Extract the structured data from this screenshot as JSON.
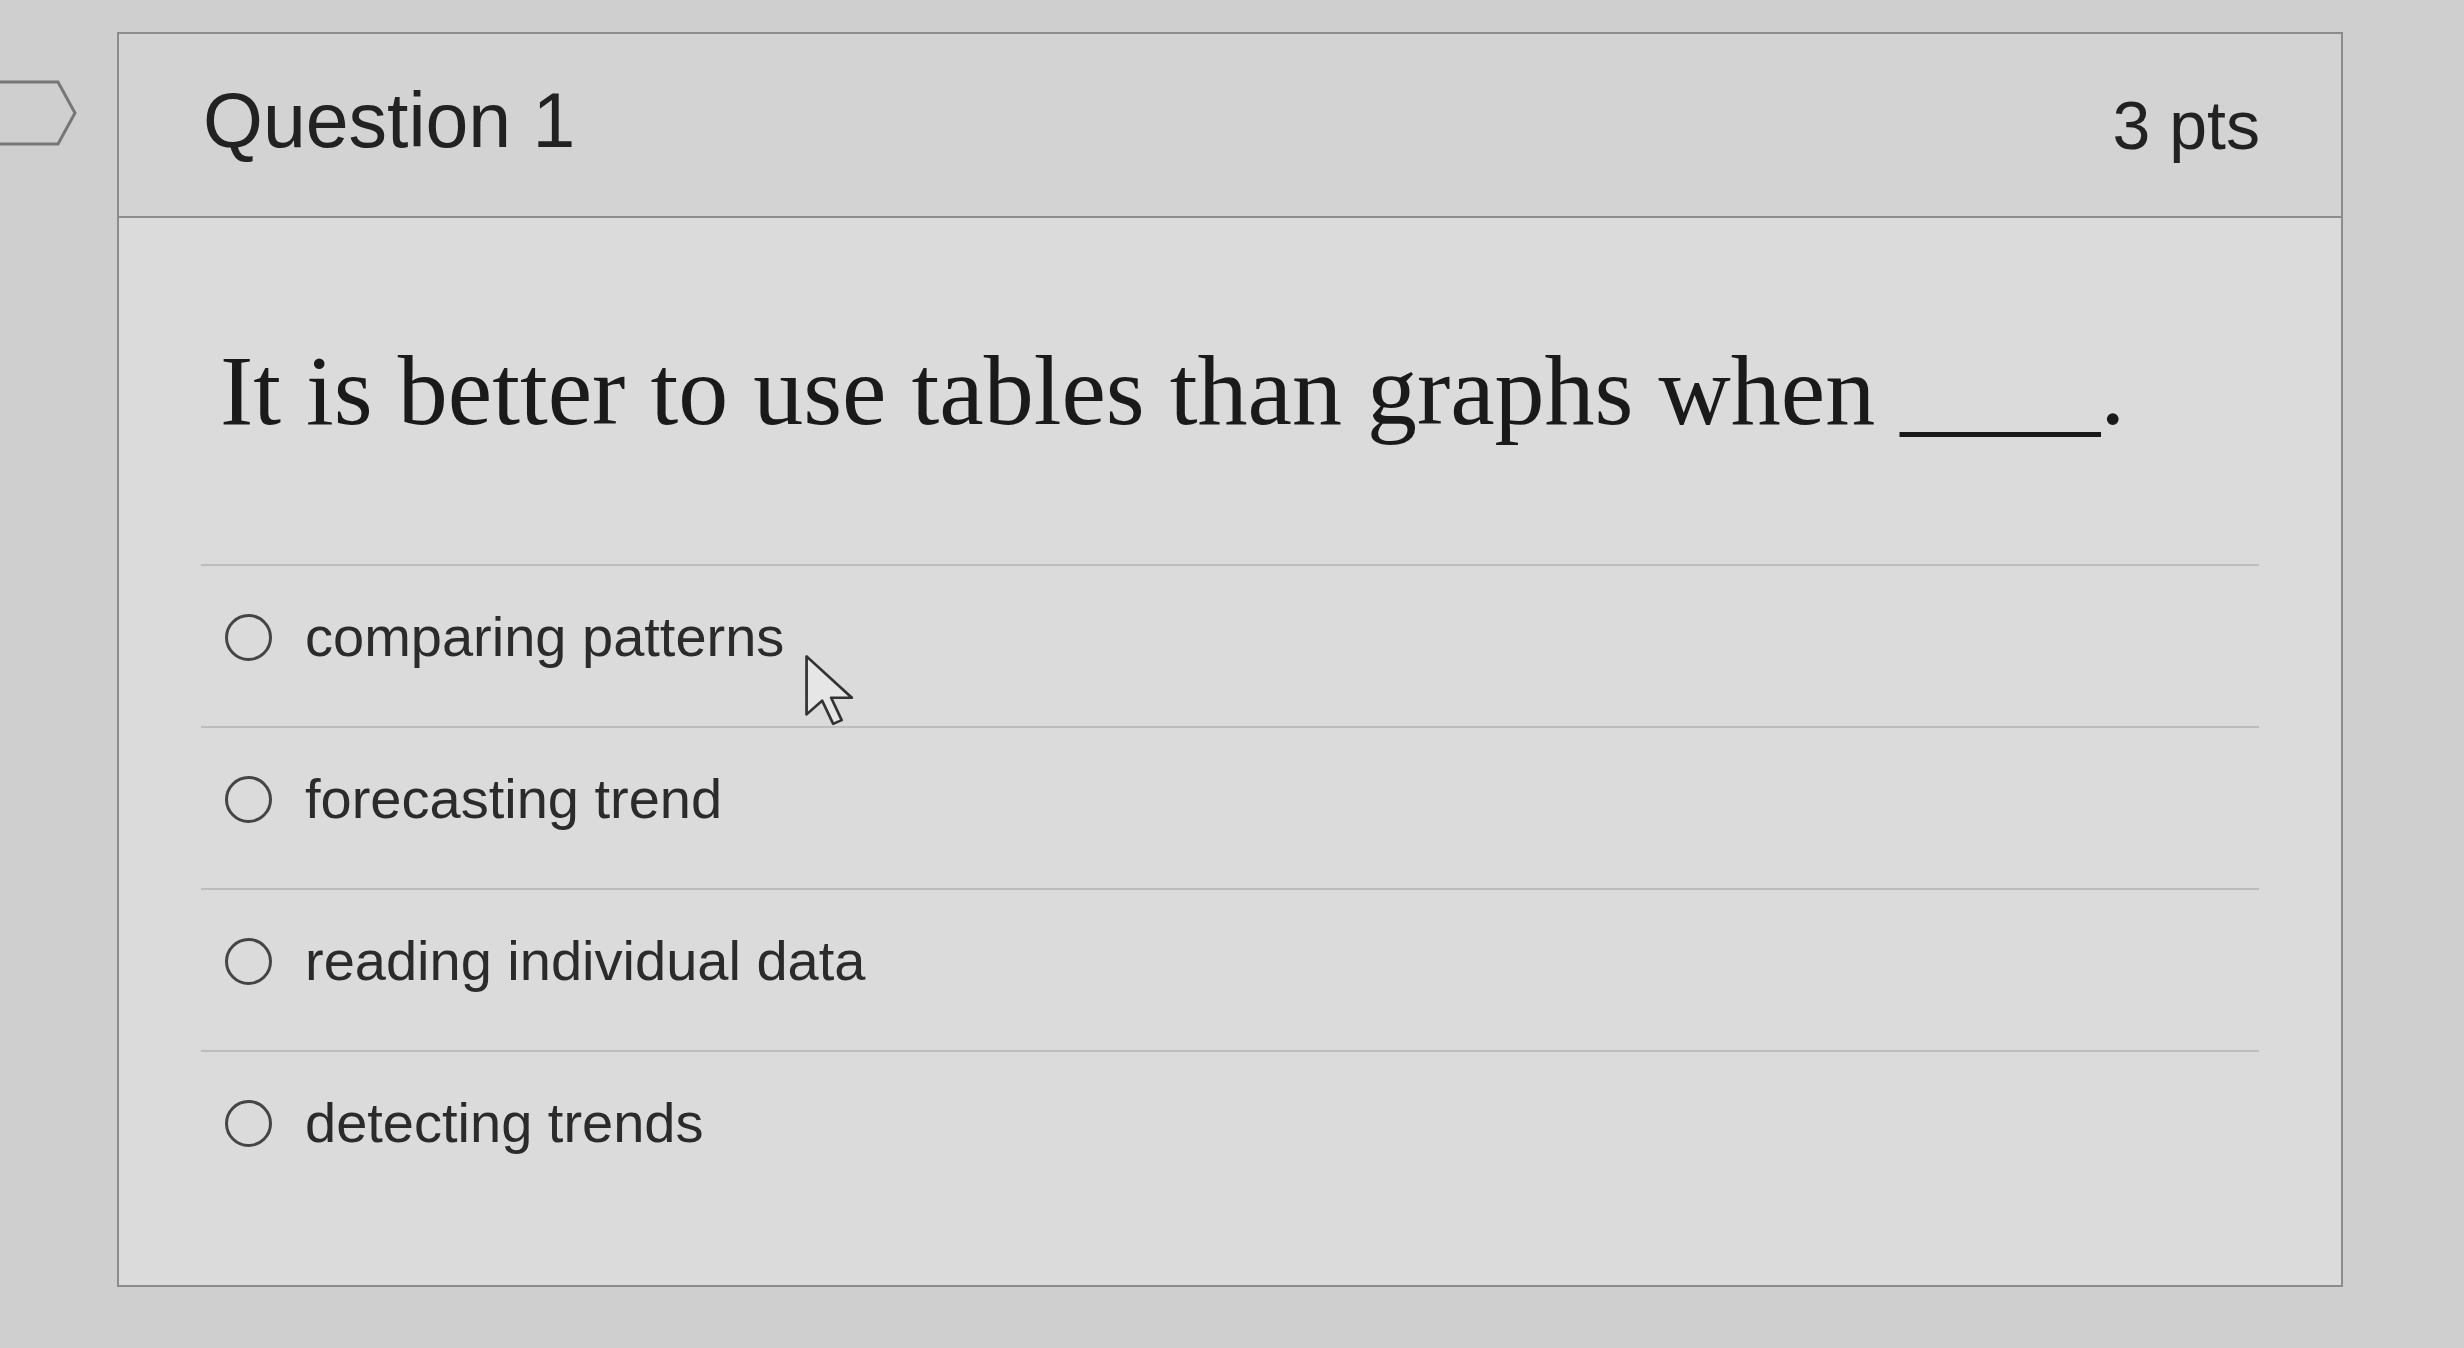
{
  "question": {
    "title": "Question 1",
    "points": "3 pts",
    "text": "It is better to use tables than graphs when ____."
  },
  "answers": [
    {
      "label": "comparing patterns",
      "selected": false
    },
    {
      "label": "forecasting trend",
      "selected": false
    },
    {
      "label": "reading individual data",
      "selected": false
    },
    {
      "label": "detecting trends",
      "selected": false
    }
  ]
}
